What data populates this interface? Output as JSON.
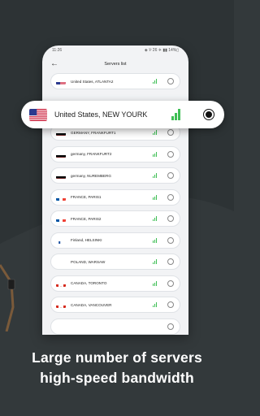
{
  "status_bar": {
    "time": "11:26",
    "icons": "◈ ⅌ 26 ✈ ▮▮ 14%▯"
  },
  "header": {
    "title": "Servers list",
    "back_icon": "arrow-left-icon"
  },
  "selected_server": {
    "name": "United States, NEW YOURK",
    "flag": "us",
    "signal_level": 3,
    "selected": true
  },
  "servers": [
    {
      "name": "United States, ATLANTA2",
      "flag": "us",
      "signal_level": 3
    },
    {
      "name": "GERMANY, FRANKFURT1",
      "flag": "de",
      "signal_level": 3
    },
    {
      "name": "germany, FRANKFURT2",
      "flag": "de",
      "signal_level": 3
    },
    {
      "name": "germany, NUREMBERG",
      "flag": "de",
      "signal_level": 3
    },
    {
      "name": "FRANCE, PARIS1",
      "flag": "fr",
      "signal_level": 3
    },
    {
      "name": "FRANCE, PARIS2",
      "flag": "fr",
      "signal_level": 3
    },
    {
      "name": "Finland, HELSINKI",
      "flag": "fi",
      "signal_level": 3
    },
    {
      "name": "POLAND, WARSAW",
      "flag": "pl",
      "signal_level": 3
    },
    {
      "name": "CANADA, TORONTO",
      "flag": "ca",
      "signal_level": 3
    },
    {
      "name": "CANADA, VANCOUVER",
      "flag": "ca",
      "signal_level": 3
    },
    {
      "name": "",
      "flag": "",
      "signal_level": 0
    }
  ],
  "caption": {
    "line1": "Large number of servers",
    "line2": "high-speed bandwidth"
  },
  "colors": {
    "background": "#33393b",
    "signal": "#3fbf55",
    "card": "#ffffff"
  }
}
